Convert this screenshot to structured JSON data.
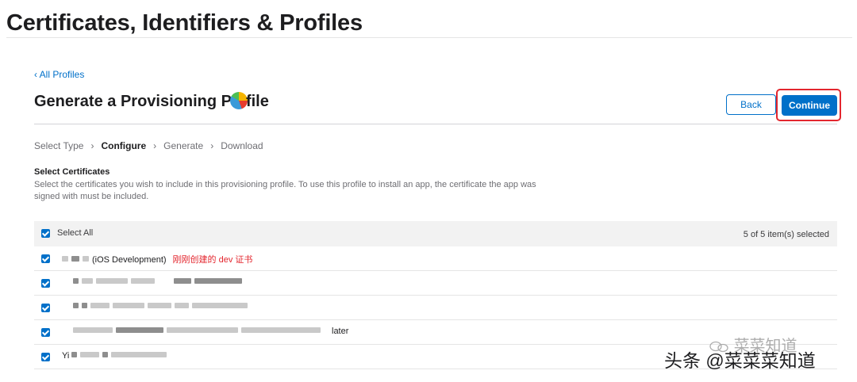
{
  "header": {
    "title": "Certificates, Identifiers & Profiles"
  },
  "nav": {
    "back_link": "‹ All Profiles"
  },
  "title_row": {
    "title_part1": "Generate a Provisioning P",
    "title_part2": "file",
    "back_button": "Back",
    "continue_button": "Continue"
  },
  "steps": [
    {
      "label": "Select Type",
      "active": false
    },
    {
      "label": "Configure",
      "active": true
    },
    {
      "label": "Generate",
      "active": false
    },
    {
      "label": "Download",
      "active": false
    }
  ],
  "section": {
    "title": "Select Certificates",
    "description": "Select the certificates you wish to include in this provisioning profile. To use this profile to install an app, the certificate the app was signed with must be included."
  },
  "table": {
    "select_all_label": "Select All",
    "count_label": "5 of 5 item(s) selected",
    "rows": [
      {
        "text": "(iOS Development)",
        "annotation": "刚刚创建的 dev 证书",
        "checked": true
      },
      {
        "text": "",
        "checked": true
      },
      {
        "text": "",
        "checked": true
      },
      {
        "text": "later",
        "checked": true
      },
      {
        "text": "Yi",
        "checked": true
      }
    ]
  },
  "watermark": {
    "line1": "菜菜知道",
    "line2": "头条 @菜菜菜知道"
  },
  "colors": {
    "accent": "#0070c9",
    "highlight": "#e3262e"
  }
}
